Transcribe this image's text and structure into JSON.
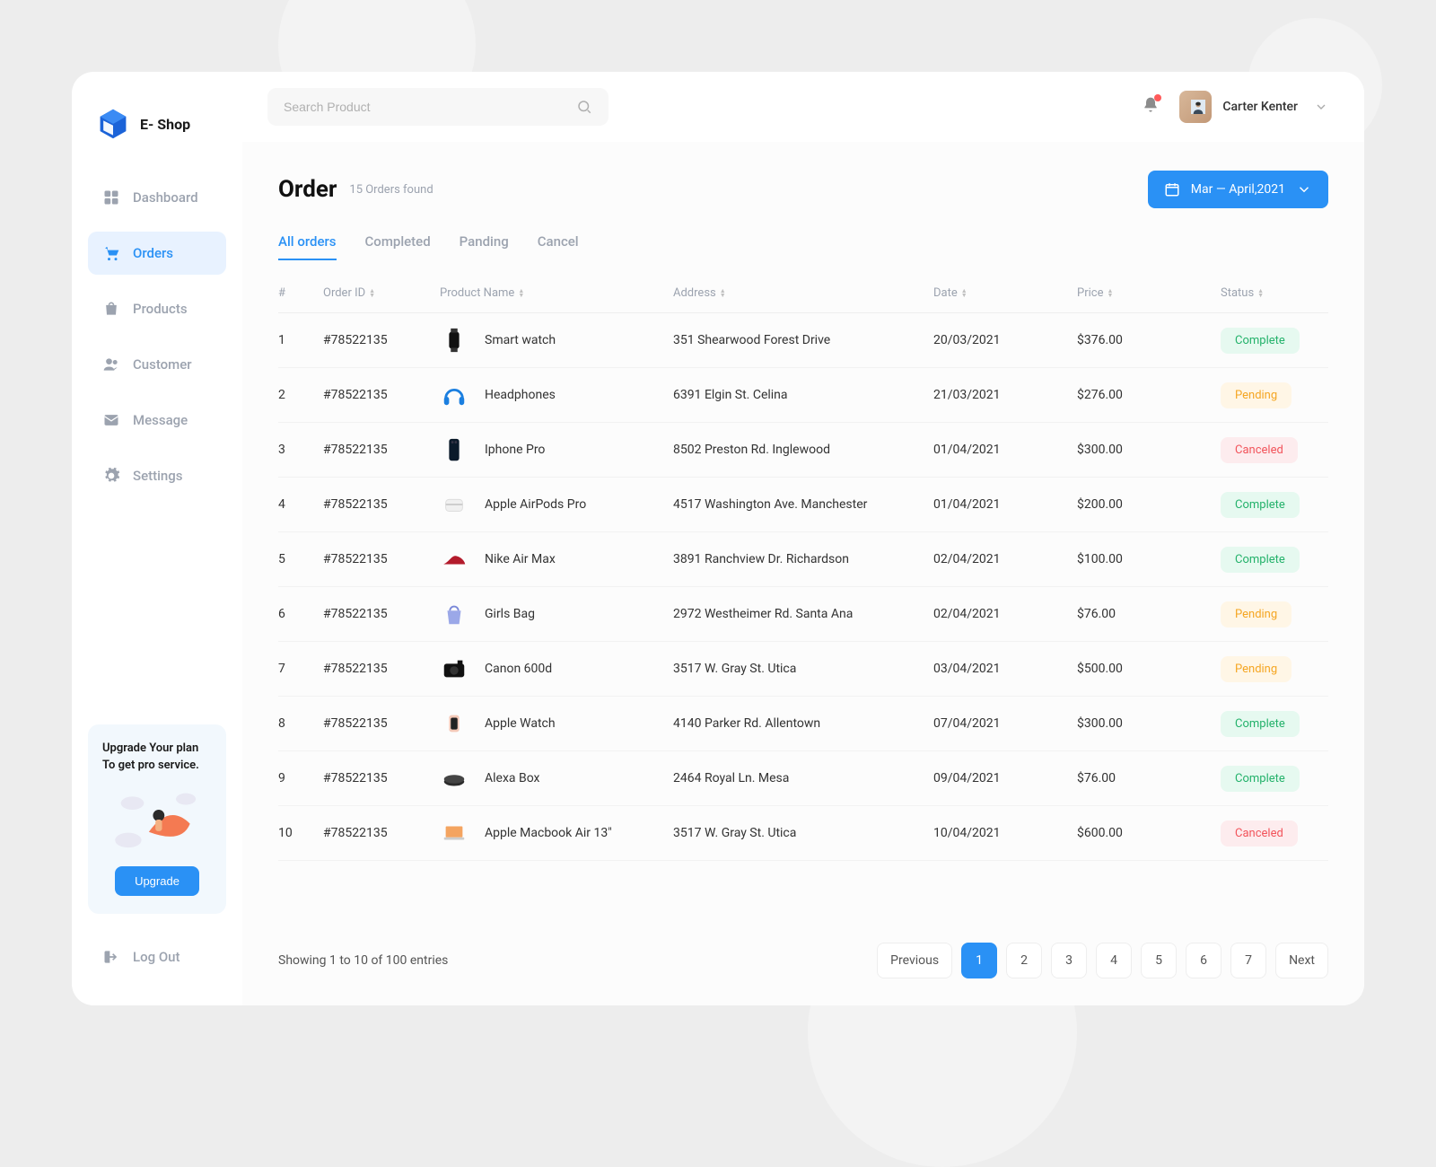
{
  "brand": "E- Shop",
  "search": {
    "placeholder": "Search Product"
  },
  "user": {
    "name": "Carter Kenter"
  },
  "sidebar": {
    "items": [
      {
        "label": "Dashboard"
      },
      {
        "label": "Orders"
      },
      {
        "label": "Products"
      },
      {
        "label": "Customer"
      },
      {
        "label": "Message"
      },
      {
        "label": "Settings"
      }
    ],
    "upgrade": {
      "line1": "Upgrade Your plan",
      "line2": "To get pro service.",
      "button": "Upgrade"
    },
    "logout": "Log Out"
  },
  "page": {
    "title": "Order",
    "subtitle": "15 Orders found",
    "date_range": "Mar — April,2021"
  },
  "tabs": [
    {
      "label": "All orders"
    },
    {
      "label": "Completed"
    },
    {
      "label": "Panding"
    },
    {
      "label": "Cancel"
    }
  ],
  "columns": {
    "num": "#",
    "order_id": "Order ID",
    "product": "Product Name",
    "address": "Address",
    "date": "Date",
    "price": "Price",
    "status": "Status"
  },
  "rows": [
    {
      "n": "1",
      "id": "#78522135",
      "product": "Smart watch",
      "address": "351  Shearwood Forest Drive",
      "date": "20/03/2021",
      "price": "$376.00",
      "status": "Complete",
      "thumb": "watch-black"
    },
    {
      "n": "2",
      "id": "#78522135",
      "product": "Headphones",
      "address": "6391 Elgin St. Celina",
      "date": "21/03/2021",
      "price": "$276.00",
      "status": "Pending",
      "thumb": "headphones-blue"
    },
    {
      "n": "3",
      "id": "#78522135",
      "product": "Iphone Pro",
      "address": "8502 Preston Rd. Inglewood",
      "date": "01/04/2021",
      "price": "$300.00",
      "status": "Canceled",
      "thumb": "phone-dark"
    },
    {
      "n": "4",
      "id": "#78522135",
      "product": "Apple AirPods Pro",
      "address": "4517 Washington Ave. Manchester",
      "date": "01/04/2021",
      "price": "$200.00",
      "status": "Complete",
      "thumb": "airpods"
    },
    {
      "n": "5",
      "id": "#78522135",
      "product": "Nike Air Max",
      "address": "3891 Ranchview Dr. Richardson",
      "date": "02/04/2021",
      "price": "$100.00",
      "status": "Complete",
      "thumb": "shoe-red"
    },
    {
      "n": "6",
      "id": "#78522135",
      "product": "Girls Bag",
      "address": "2972 Westheimer Rd. Santa Ana",
      "date": "02/04/2021",
      "price": "$76.00",
      "status": "Pending",
      "thumb": "bag-purple"
    },
    {
      "n": "7",
      "id": "#78522135",
      "product": "Canon 600d",
      "address": "3517 W. Gray St. Utica",
      "date": "03/04/2021",
      "price": "$500.00",
      "status": "Pending",
      "thumb": "camera"
    },
    {
      "n": "8",
      "id": "#78522135",
      "product": "Apple Watch",
      "address": "4140 Parker Rd. Allentown",
      "date": "07/04/2021",
      "price": "$300.00",
      "status": "Complete",
      "thumb": "watch-pink"
    },
    {
      "n": "9",
      "id": "#78522135",
      "product": "Alexa Box",
      "address": "2464 Royal Ln. Mesa",
      "date": "09/04/2021",
      "price": "$76.00",
      "status": "Complete",
      "thumb": "alexa"
    },
    {
      "n": "10",
      "id": "#78522135",
      "product": "Apple Macbook Air 13\"",
      "address": "3517 W. Gray St. Utica",
      "date": "10/04/2021",
      "price": "$600.00",
      "status": "Canceled",
      "thumb": "macbook"
    }
  ],
  "pagination": {
    "info": "Showing 1 to 10 of 100 entries",
    "prev": "Previous",
    "next": "Next",
    "pages": [
      "1",
      "2",
      "3",
      "4",
      "5",
      "6",
      "7"
    ]
  }
}
